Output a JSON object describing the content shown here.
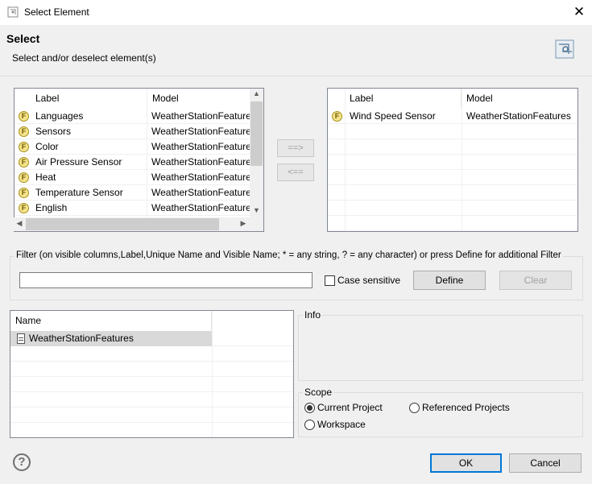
{
  "window": {
    "title": "Select Element",
    "close_glyph": "✕"
  },
  "header": {
    "title": "Select",
    "subtitle": "Select and/or deselect element(s)"
  },
  "available_table": {
    "columns": [
      "Label",
      "Model"
    ],
    "rows": [
      {
        "icon": "F",
        "label": "Languages",
        "model": "WeatherStationFeatures"
      },
      {
        "icon": "F",
        "label": "Sensors",
        "model": "WeatherStationFeatures"
      },
      {
        "icon": "F",
        "label": "Color",
        "model": "WeatherStationFeatures"
      },
      {
        "icon": "F",
        "label": "Air Pressure Sensor",
        "model": "WeatherStationFeatures"
      },
      {
        "icon": "F",
        "label": "Heat",
        "model": "WeatherStationFeatures"
      },
      {
        "icon": "F",
        "label": "Temperature Sensor",
        "model": "WeatherStationFeatures"
      },
      {
        "icon": "F",
        "label": "English",
        "model": "WeatherStationFeatures"
      }
    ]
  },
  "move_buttons": {
    "add_label": "==>",
    "remove_label": "<=="
  },
  "selected_table": {
    "columns": [
      "Label",
      "Model"
    ],
    "rows": [
      {
        "icon": "F",
        "label": "Wind Speed Sensor",
        "model": "WeatherStationFeatures"
      }
    ]
  },
  "filter": {
    "group_label": "Filter (on visible columns,Label,Unique Name and Visible Name; * = any string, ? = any character) or press Define for additional Filter",
    "input_value": "",
    "case_sensitive_label": "Case sensitive",
    "define_label": "Define",
    "clear_label": "Clear"
  },
  "models_table": {
    "column": "Name",
    "rows": [
      {
        "label": "WeatherStationFeatures"
      }
    ]
  },
  "info": {
    "group_label": "Info"
  },
  "scope": {
    "group_label": "Scope",
    "options": [
      {
        "label": "Current Project",
        "checked": true
      },
      {
        "label": "Referenced Projects",
        "checked": false
      },
      {
        "label": "Workspace",
        "checked": false
      }
    ]
  },
  "footer": {
    "help_glyph": "?",
    "ok_label": "OK",
    "cancel_label": "Cancel"
  },
  "colors": {
    "accent": "#0078d7",
    "feature_icon_fill": "#f4e38c",
    "selection": "#d9d9d9"
  }
}
